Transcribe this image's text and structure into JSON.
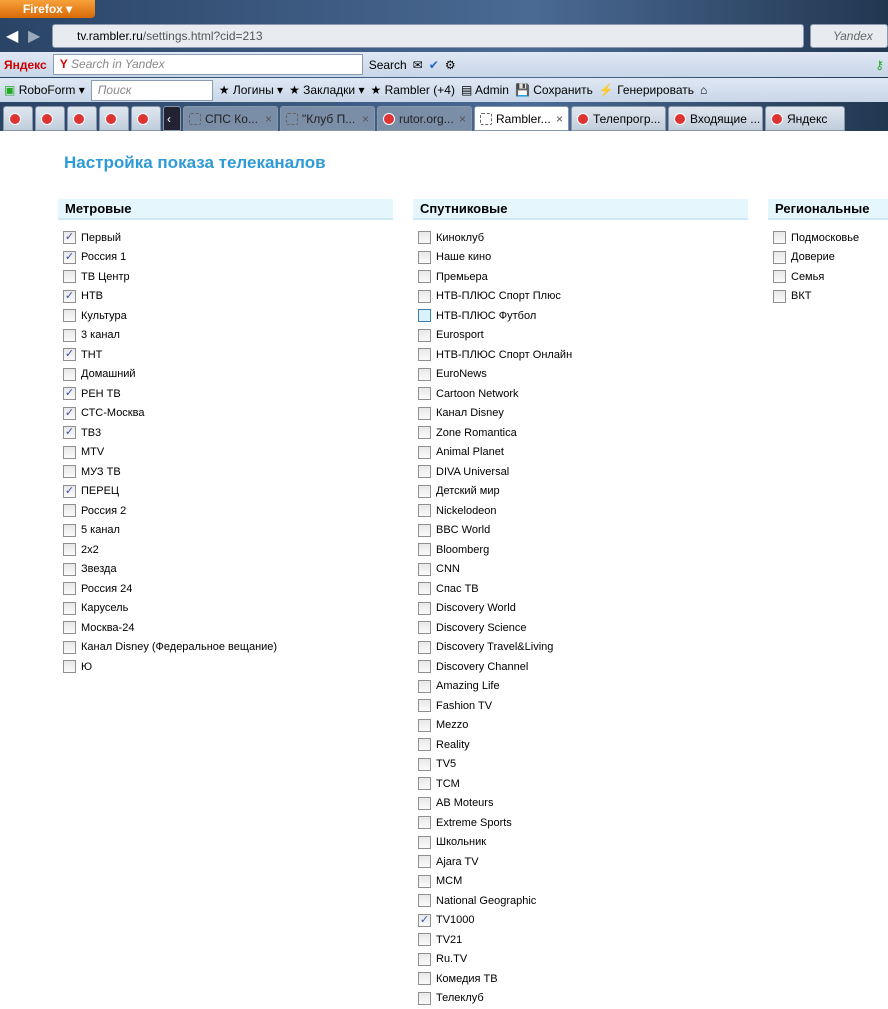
{
  "browser": {
    "menu_button": "Firefox",
    "url_host": "tv.rambler.ru",
    "url_path": "/settings.html?cid=213",
    "search_engine": "Yandex"
  },
  "yandex_bar": {
    "brand": "Яндекс",
    "search_placeholder": "Search in Yandex",
    "search_button": "Search"
  },
  "roboform_bar": {
    "brand": "RoboForm",
    "search_placeholder": "Поиск",
    "items": [
      "Логины",
      "Закладки",
      "Rambler",
      "(+4)",
      "Admin",
      "Сохранить",
      "Генерировать"
    ]
  },
  "tabs": [
    {
      "label": "",
      "fav": "red"
    },
    {
      "label": "",
      "fav": "red"
    },
    {
      "label": "",
      "fav": "red"
    },
    {
      "label": "",
      "fav": "red"
    },
    {
      "label": "",
      "fav": "red"
    },
    {
      "label": "СПС Ко...",
      "fav": "blank",
      "dim": true
    },
    {
      "label": "\"Клуб П...",
      "fav": "blank",
      "dim": true
    },
    {
      "label": "rutor.org...",
      "fav": "red",
      "dim": true
    },
    {
      "label": "Rambler...",
      "fav": "blank",
      "active": true
    },
    {
      "label": "Телепрогр...",
      "fav": "red"
    },
    {
      "label": "Входящие ...",
      "fav": "red"
    },
    {
      "label": "Яндекс",
      "fav": "red"
    }
  ],
  "page": {
    "title": "Настройка показа телеканалов"
  },
  "columns": [
    {
      "title": "Метровые",
      "items": [
        [
          "Первый",
          1
        ],
        [
          "Россия 1",
          1
        ],
        [
          "ТВ Центр",
          0
        ],
        [
          "НТВ",
          1
        ],
        [
          "Культура",
          0
        ],
        [
          "3 канал",
          0
        ],
        [
          "ТНТ",
          1
        ],
        [
          "Домашний",
          0
        ],
        [
          "РЕН ТВ",
          1
        ],
        [
          "СТС-Москва",
          1
        ],
        [
          "ТВ3",
          1
        ],
        [
          "MTV",
          0
        ],
        [
          "МУЗ ТВ",
          0
        ],
        [
          "ПЕРЕЦ",
          1
        ],
        [
          "Россия 2",
          0
        ],
        [
          "5 канал",
          0
        ],
        [
          "2х2",
          0
        ],
        [
          "Звезда",
          0
        ],
        [
          "Россия 24",
          0
        ],
        [
          "Карусель",
          0
        ],
        [
          "Москва-24",
          0
        ],
        [
          "Канал Disney (Федеральное вещание)",
          0
        ],
        [
          "Ю",
          0
        ]
      ]
    },
    {
      "title": "Спутниковые",
      "items": [
        [
          "Киноклуб",
          0
        ],
        [
          "Наше кино",
          0
        ],
        [
          "Премьера",
          0
        ],
        [
          "НТВ-ПЛЮС Спорт Плюс",
          0
        ],
        [
          "НТВ-ПЛЮС Футбол",
          0
        ],
        [
          "Eurosport",
          0
        ],
        [
          "НТВ-ПЛЮС Спорт Онлайн",
          0
        ],
        [
          "EuroNews",
          0
        ],
        [
          "Cartoon Network",
          0
        ],
        [
          "Канал Disney",
          0
        ],
        [
          "Zone Romantica",
          0
        ],
        [
          "Animal Planet",
          0
        ],
        [
          "DIVA Universal",
          0
        ],
        [
          "Детский мир",
          0
        ],
        [
          "Nickelodeon",
          0
        ],
        [
          "BBC World",
          0
        ],
        [
          "Bloomberg",
          0
        ],
        [
          "CNN",
          0
        ],
        [
          "Спас ТВ",
          0
        ],
        [
          "Discovery World",
          0
        ],
        [
          "Discovery Science",
          0
        ],
        [
          "Discovery Travel&Living",
          0
        ],
        [
          "Discovery Channel",
          0
        ],
        [
          "Amazing Life",
          0
        ],
        [
          "Fashion TV",
          0
        ],
        [
          "Mezzo",
          0
        ],
        [
          "Reality",
          0
        ],
        [
          "TV5",
          0
        ],
        [
          "TCM",
          0
        ],
        [
          "AB Moteurs",
          0
        ],
        [
          "Extreme Sports",
          0
        ],
        [
          "Школьник",
          0
        ],
        [
          "Ajara TV",
          0
        ],
        [
          "MCM",
          0
        ],
        [
          "National Geographic",
          0
        ],
        [
          "TV1000",
          1
        ],
        [
          "TV21",
          0
        ],
        [
          "Ru.TV",
          0
        ],
        [
          "Комедия ТВ",
          0
        ],
        [
          "Телеклуб",
          0
        ]
      ]
    },
    {
      "title": "Региональные",
      "items": [
        [
          "Подмосковье",
          0
        ],
        [
          "Доверие",
          0
        ],
        [
          "Семья",
          0
        ],
        [
          "ВКТ",
          0
        ]
      ]
    }
  ]
}
